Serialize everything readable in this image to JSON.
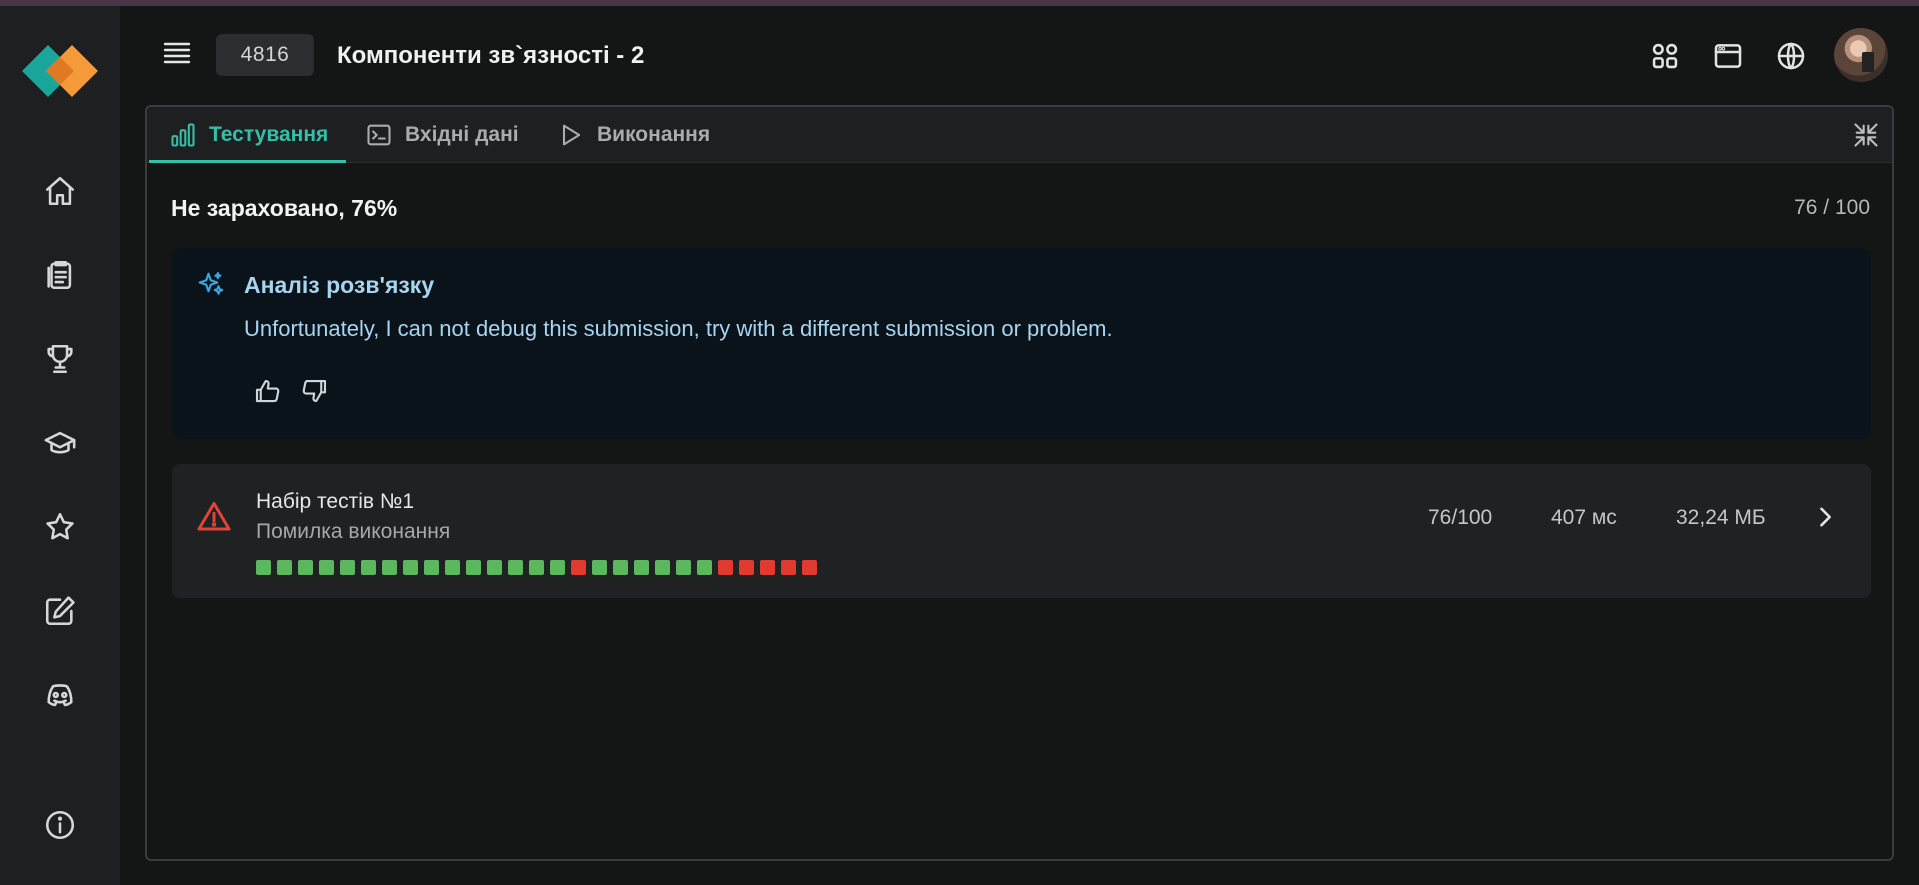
{
  "header": {
    "problem_id": "4816",
    "problem_title": "Компоненти зв`язності - 2"
  },
  "sidebar": {
    "items": [
      {
        "name": "home-icon"
      },
      {
        "name": "problems-icon"
      },
      {
        "name": "trophy-icon"
      },
      {
        "name": "graduation-cap-icon"
      },
      {
        "name": "star-icon"
      },
      {
        "name": "edit-icon"
      },
      {
        "name": "discord-icon"
      },
      {
        "name": "info-icon"
      }
    ]
  },
  "tabs": [
    {
      "label": "Тестування",
      "icon": "bar-chart-icon",
      "active": true
    },
    {
      "label": "Вхідні дані",
      "icon": "terminal-icon",
      "active": false
    },
    {
      "label": "Виконання",
      "icon": "play-icon",
      "active": false
    }
  ],
  "result": {
    "verdict": "Не зараховано, 76%",
    "score": "76 / 100"
  },
  "analysis": {
    "title": "Аналіз розв'язку",
    "message": "Unfortunately, I can not debug this submission, try with a different submission or problem."
  },
  "testset": {
    "name": "Набір тестів №1",
    "status": "Помилка виконання",
    "score": "76/100",
    "time": "407 мс",
    "memory": "32,24 МБ",
    "tests": [
      "pass",
      "pass",
      "pass",
      "pass",
      "pass",
      "pass",
      "pass",
      "pass",
      "pass",
      "pass",
      "pass",
      "pass",
      "pass",
      "pass",
      "pass",
      "fail",
      "pass",
      "pass",
      "pass",
      "pass",
      "pass",
      "pass",
      "fail",
      "fail",
      "fail",
      "fail",
      "fail"
    ]
  },
  "colors": {
    "accent": "#34bfa8",
    "pass": "#5cb85c",
    "fail": "#e23a2e",
    "analysis_text": "#a8d4f0"
  }
}
